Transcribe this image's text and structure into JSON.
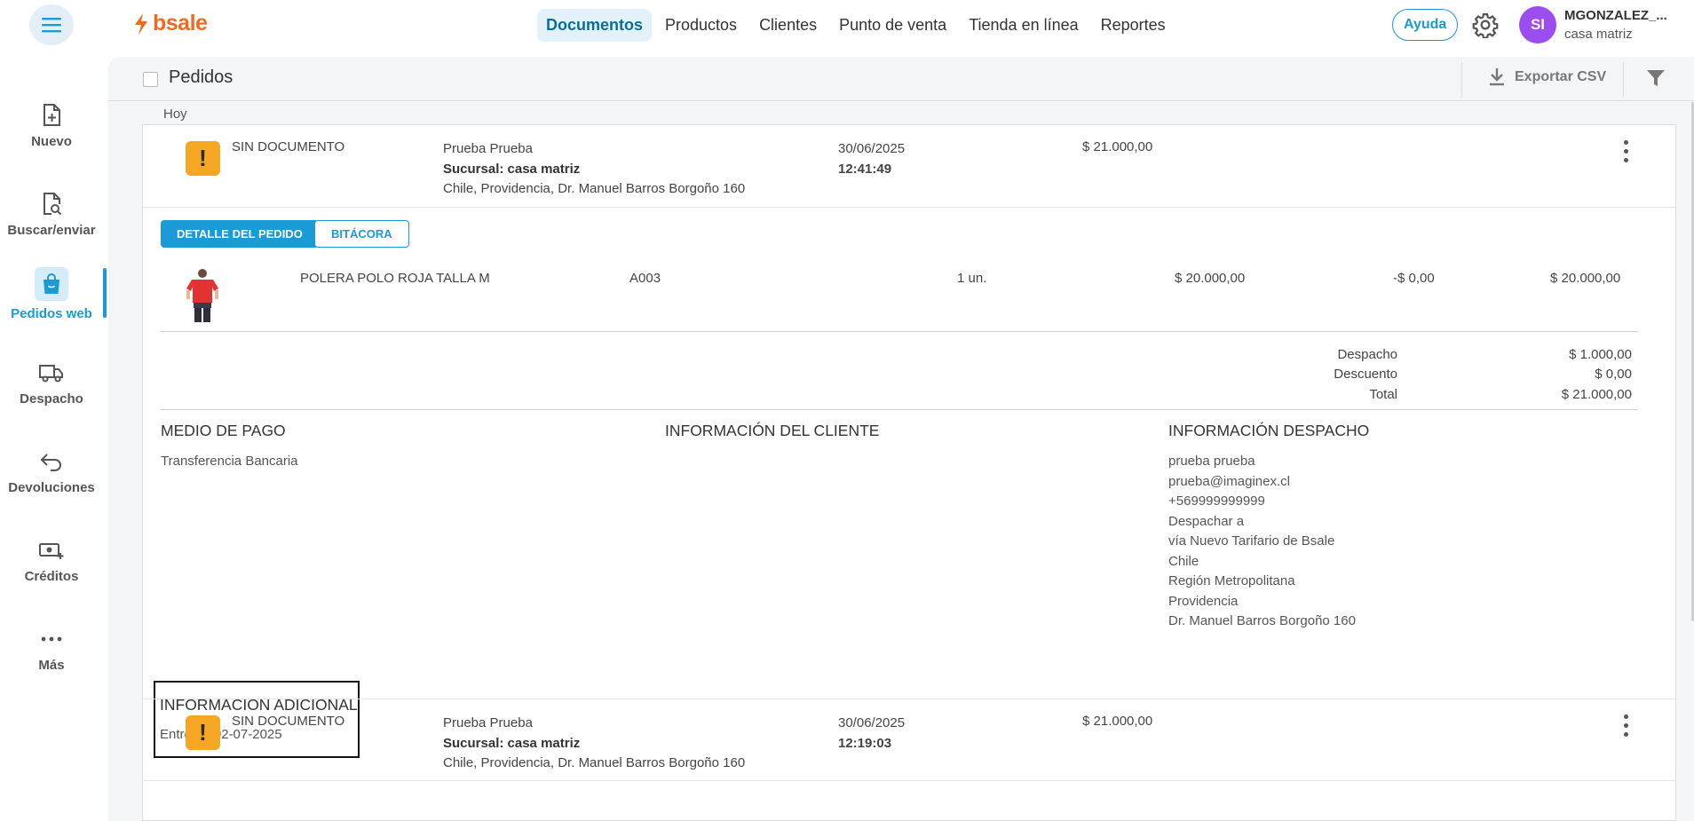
{
  "brand": {
    "name": "bsale",
    "color": "#f26a21",
    "accent": "#1a9ad6"
  },
  "nav": {
    "items": [
      "Documentos",
      "Productos",
      "Clientes",
      "Punto de venta",
      "Tienda en línea",
      "Reportes"
    ],
    "active": "Documentos"
  },
  "header_right": {
    "help": "Ayuda",
    "avatar_initials": "SI",
    "user_name": "MGONZALEZ_...",
    "user_branch": "casa matriz"
  },
  "sidebar": {
    "items": [
      {
        "label": "Nuevo",
        "icon": "file-plus-icon"
      },
      {
        "label": "Buscar/enviar",
        "icon": "file-search-icon"
      },
      {
        "label": "Pedidos web",
        "icon": "shopping-bag-icon"
      },
      {
        "label": "Despacho",
        "icon": "truck-icon"
      },
      {
        "label": "Devoluciones",
        "icon": "return-arrow-icon"
      },
      {
        "label": "Créditos",
        "icon": "money-plus-icon"
      },
      {
        "label": "Más",
        "icon": "more-dots-icon"
      }
    ],
    "active": "Pedidos web"
  },
  "page": {
    "title": "Pedidos",
    "export_label": "Exportar CSV",
    "group_label": "Hoy"
  },
  "orders": [
    {
      "doc_type": "SIN DOCUMENTO",
      "client_name": "Prueba Prueba",
      "branch_prefix": "Sucursal:",
      "branch": "casa matriz",
      "address": "Chile, Providencia, Dr. Manuel Barros Borgoño 160",
      "date": "30/06/2025",
      "time": "12:41:49",
      "amount": "$ 21.000,00"
    },
    {
      "doc_type": "SIN DOCUMENTO",
      "client_name": "Prueba Prueba",
      "branch_prefix": "Sucursal:",
      "branch": "casa matriz",
      "address": "Chile, Providencia, Dr. Manuel Barros Borgoño 160",
      "date": "30/06/2025",
      "time": "12:19:03",
      "amount": "$ 21.000,00"
    }
  ],
  "detail": {
    "tabs": {
      "detail": "DETALLE DEL PEDIDO",
      "log": "BITÁCORA"
    },
    "product": {
      "name": "POLERA POLO ROJA TALLA M",
      "sku": "A003",
      "qty": "1 un.",
      "price": "$ 20.000,00",
      "discount": "-$ 0,00",
      "total": "$ 20.000,00"
    },
    "summary": {
      "shipping_label": "Despacho",
      "shipping": "$ 1.000,00",
      "discount_label": "Descuento",
      "discount": "$ 0,00",
      "total_label": "Total",
      "total": "$ 21.000,00"
    },
    "payment": {
      "title": "MEDIO DE PAGO",
      "method": "Transferencia Bancaria"
    },
    "customer": {
      "title": "INFORMACIÓN DEL CLIENTE"
    },
    "shipping_info": {
      "title": "INFORMACIÓN DESPACHO",
      "lines": [
        "prueba prueba",
        "prueba@imaginex.cl",
        "+569999999999",
        "Despachar a",
        "vía Nuevo Tarifario de Bsale",
        "Chile",
        "Región Metropolitana",
        "Providencia",
        "Dr. Manuel Barros Borgoño 160"
      ]
    },
    "additional": {
      "title": "INFORMACION ADICIONAL",
      "delivery": "Entrega: 02-07-2025"
    }
  }
}
